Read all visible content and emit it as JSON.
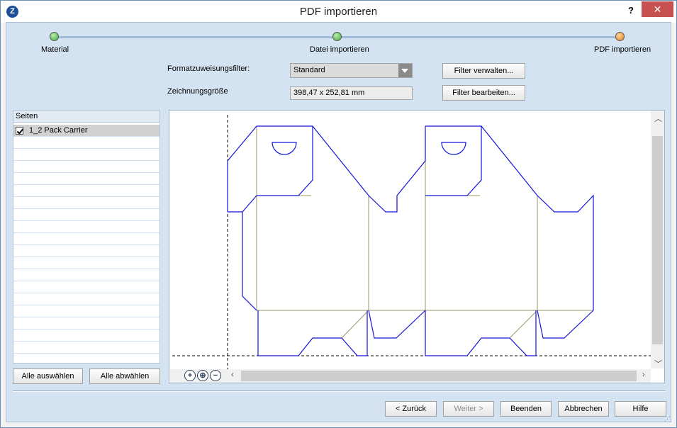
{
  "window": {
    "title": "PDF importieren",
    "app_icon": "app-logo-icon",
    "help_glyph": "?",
    "close_glyph": "✕"
  },
  "steps": [
    {
      "label": "Material",
      "state": "done",
      "color": "#3fa73a"
    },
    {
      "label": "Datei importieren",
      "state": "done",
      "color": "#3fa73a"
    },
    {
      "label": "PDF importieren",
      "state": "current",
      "color": "#e67f12"
    }
  ],
  "format_filter": {
    "label": "Formatzuweisungsfilter:",
    "selected": "Standard",
    "manage_button": "Filter verwalten..."
  },
  "drawing_size": {
    "label": "Zeichnungsgröße",
    "value": "398,47 x 252,81 mm",
    "edit_button": "Filter bearbeiten..."
  },
  "pages_list": {
    "header": "Seiten",
    "items": [
      {
        "label": "1_2 Pack Carrier",
        "checked": true,
        "selected": true
      }
    ],
    "select_all_button": "Alle auswählen",
    "deselect_all_button": "Alle abwählen"
  },
  "preview": {
    "cut_line_color": "#1515d8",
    "fold_line_color": "#9a9a6a",
    "zoom_in_icon": "zoom-in-icon",
    "zoom_fit_icon": "zoom-fit-icon",
    "zoom_out_icon": "zoom-out-icon"
  },
  "footer": {
    "back_button": "< Zurück",
    "next_button": "Weiter >",
    "finish_button": "Beenden",
    "cancel_button": "Abbrechen",
    "help_button": "Hilfe"
  }
}
